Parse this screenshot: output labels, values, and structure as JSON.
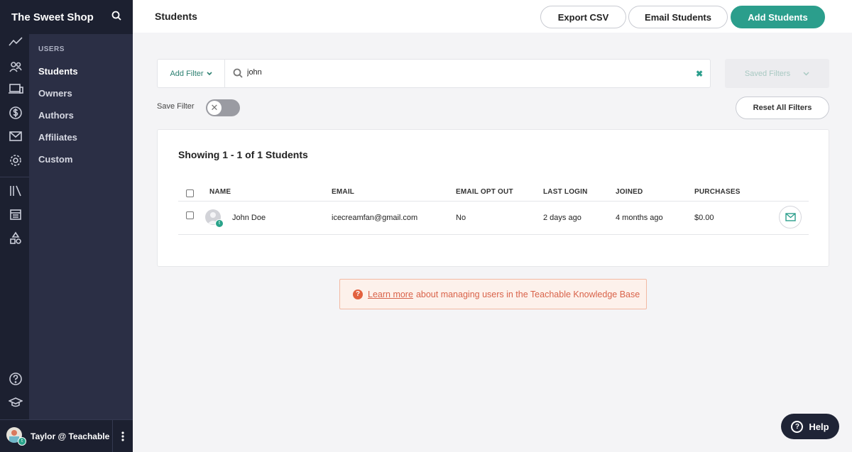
{
  "app": {
    "brand": "The Sweet Shop"
  },
  "sidebar": {
    "section_title": "USERS",
    "items": [
      {
        "label": "Students",
        "active": true
      },
      {
        "label": "Owners"
      },
      {
        "label": "Authors"
      },
      {
        "label": "Affiliates"
      },
      {
        "label": "Custom"
      }
    ],
    "rail_icons": [
      "analytics-icon",
      "users-icon",
      "sites-icon",
      "sales-icon",
      "email-icon",
      "settings-icon",
      "library-icon",
      "calendar-icon",
      "shapes-icon",
      "help-circle-icon",
      "graduation-cap-icon"
    ]
  },
  "user": {
    "name": "Taylor @ Teachable",
    "badge": "t"
  },
  "header": {
    "title": "Students",
    "export_label": "Export CSV",
    "email_label": "Email Students",
    "add_label": "Add Students"
  },
  "filters": {
    "add_filter_label": "Add Filter",
    "search_value": "john",
    "clear_symbol": "✖",
    "saved_filters_label": "Saved Filters",
    "save_filter_label": "Save Filter",
    "save_filter_enabled": false,
    "reset_label": "Reset All Filters"
  },
  "table": {
    "summary": "Showing 1 - 1 of 1 Students",
    "columns": [
      "NAME",
      "EMAIL",
      "EMAIL OPT OUT",
      "LAST LOGIN",
      "JOINED",
      "PURCHASES"
    ],
    "rows": [
      {
        "name": "John Doe",
        "badge": "t",
        "email": "icecreamfan@gmail.com",
        "opt_out": "No",
        "last_login": "2 days ago",
        "joined": "4 months ago",
        "purchases": "$0.00"
      }
    ]
  },
  "banner": {
    "icon": "?",
    "link_text": "Learn more",
    "text": "about managing users in the Teachable Knowledge Base"
  },
  "help": {
    "label": "Help",
    "icon": "?"
  },
  "colors": {
    "accent": "#2b9e8c",
    "sidebar_dark": "#1c2030",
    "sidebar_sub": "#2b2f45",
    "banner_text": "#d9634a"
  }
}
